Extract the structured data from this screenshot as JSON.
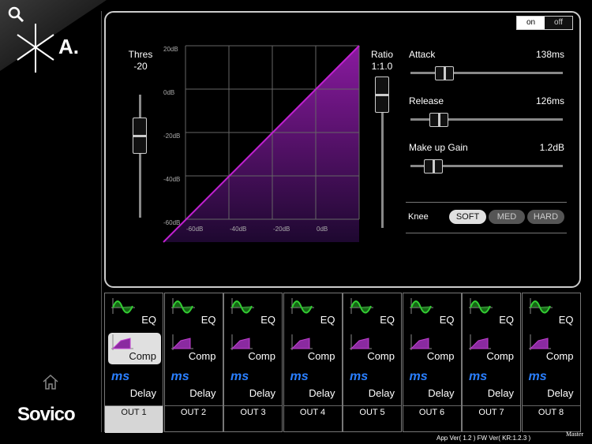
{
  "header": {
    "logo_text": "A.",
    "brand": "Sovico"
  },
  "toggle": {
    "on": "on",
    "off": "off",
    "state": "on"
  },
  "threshold": {
    "label": "Thres",
    "value": "-20"
  },
  "ratio": {
    "label": "Ratio",
    "value": "1:1.0"
  },
  "graph": {
    "y_ticks": [
      "20dB",
      "0dB",
      "-20dB",
      "-40dB",
      "-60dB"
    ],
    "x_ticks": [
      "-60dB",
      "-40dB",
      "-20dB",
      "0dB"
    ],
    "color": "#b020c0"
  },
  "params": [
    {
      "label": "Attack",
      "value": "138ms",
      "level": 0.18
    },
    {
      "label": "Release",
      "value": "126ms",
      "level": 0.14
    },
    {
      "label": "Make up Gain",
      "value": "1.2dB",
      "level": 0.1
    }
  ],
  "knee": {
    "label": "Knee",
    "options": [
      "SOFT",
      "MED",
      "HARD"
    ],
    "selected": "SOFT"
  },
  "outputs": [
    {
      "name": "OUT 1",
      "eq": "EQ",
      "comp": "Comp",
      "delay_icon": "ms",
      "delay": "Delay"
    },
    {
      "name": "OUT 2",
      "eq": "EQ",
      "comp": "Comp",
      "delay_icon": "ms",
      "delay": "Delay"
    },
    {
      "name": "OUT 3",
      "eq": "EQ",
      "comp": "Comp",
      "delay_icon": "ms",
      "delay": "Delay"
    },
    {
      "name": "OUT 4",
      "eq": "EQ",
      "comp": "Comp",
      "delay_icon": "ms",
      "delay": "Delay"
    },
    {
      "name": "OUT 5",
      "eq": "EQ",
      "comp": "Comp",
      "delay_icon": "ms",
      "delay": "Delay"
    },
    {
      "name": "OUT 6",
      "eq": "EQ",
      "comp": "Comp",
      "delay_icon": "ms",
      "delay": "Delay"
    },
    {
      "name": "OUT 7",
      "eq": "EQ",
      "comp": "Comp",
      "delay_icon": "ms",
      "delay": "Delay"
    },
    {
      "name": "OUT 8",
      "eq": "EQ",
      "comp": "Comp",
      "delay_icon": "ms",
      "delay": "Delay"
    }
  ],
  "footer": {
    "version": "App Ver( 1.2 ) FW Ver( KR:1.2.3 )",
    "master": "Master"
  }
}
